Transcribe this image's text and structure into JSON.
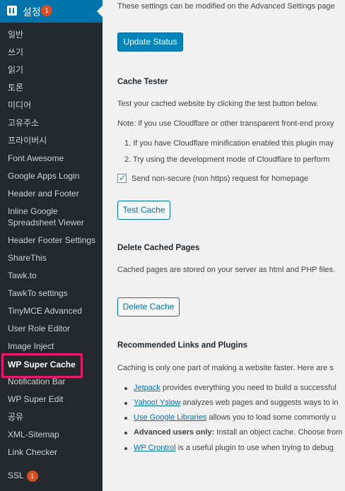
{
  "sidebar": {
    "header": {
      "label": "설정",
      "badge": "1"
    },
    "items": [
      "일반",
      "쓰기",
      "읽기",
      "토론",
      "미디어",
      "고유주소",
      "프라이버시",
      "Font Awesome",
      "Google Apps Login",
      "Header and Footer",
      "Inline Google",
      "Spreadsheet Viewer",
      "Header Footer Settings",
      "ShareThis",
      "Tawk.to",
      "TawkTo settings",
      "TinyMCE Advanced",
      "User Role Editor",
      "Image Inject",
      "WP Super Cache",
      "Notification Bar",
      "WP Super Edit",
      "공유",
      "XML-Sitemap",
      "Link Checker"
    ],
    "ssl": {
      "label": "SSL",
      "badge": "1"
    }
  },
  "main": {
    "intro": "These settings can be modified on the Advanced Settings page",
    "update_button": "Update Status",
    "cache_tester": {
      "heading": "Cache Tester",
      "desc": "Test your cached website by clicking the test button below.",
      "note": "Note: if you use Cloudflare or other transparent front-end proxy",
      "list": [
        "1. If you have Cloudflare minification enabled this plugin may",
        "2. Try using the development mode of Cloudflare to perform"
      ],
      "checkbox_label": "Send non-secure (non https) request for homepage",
      "test_button": "Test Cache"
    },
    "delete_cached": {
      "heading": "Delete Cached Pages",
      "desc": "Cached pages are stored on your server as html and PHP files.",
      "button": "Delete Cache"
    },
    "recommended": {
      "heading": "Recommended Links and Plugins",
      "desc": "Caching is only one part of making a website faster. Here are s",
      "items": [
        {
          "link": "Jetpack",
          "text": " provides everything you need to build a successful"
        },
        {
          "link": "Yahoo! Yslow",
          "text": " analyzes web pages and suggests ways to in"
        },
        {
          "link": "Use Google Libraries",
          "text": " allows you to load some commonly u"
        },
        {
          "bold": "Advanced users only:",
          "text": " Install an object cache. Choose from"
        },
        {
          "link": "WP Crontrol",
          "text": " is a useful plugin to use when trying to debug"
        }
      ]
    }
  },
  "colors": {
    "sidebar_bg": "#23282d",
    "accent": "#0073aa",
    "highlight": "#e8196c",
    "badge": "#d54e21"
  }
}
